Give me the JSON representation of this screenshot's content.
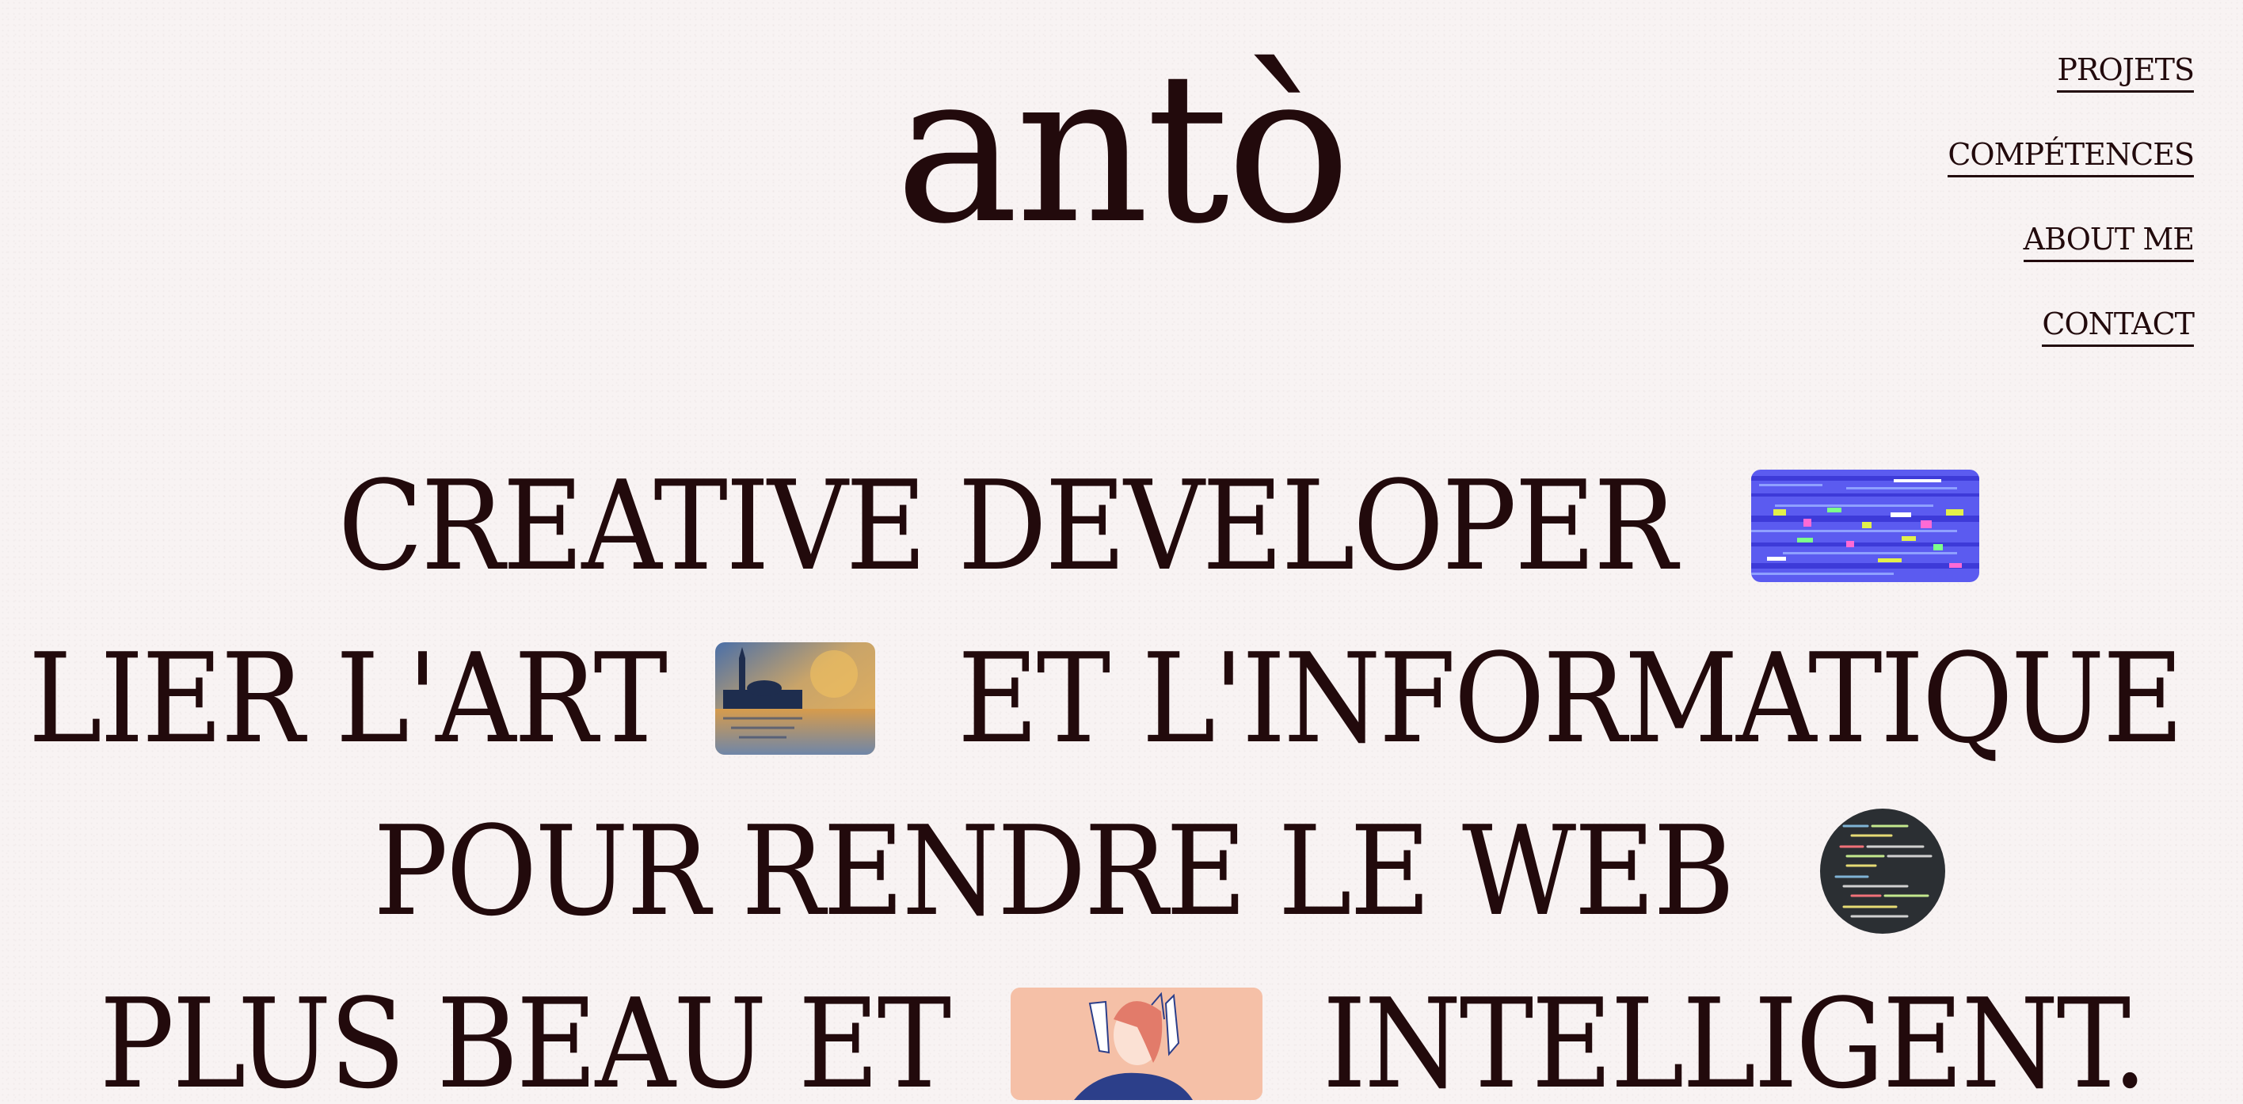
{
  "site": {
    "logo": "antò"
  },
  "nav": {
    "items": [
      {
        "label": "PROJETS"
      },
      {
        "label": "COMPÉTENCES"
      },
      {
        "label": "ABOUT ME"
      },
      {
        "label": "CONTACT"
      }
    ]
  },
  "hero": {
    "line1": {
      "text": "CREATIVE DEVELOPER"
    },
    "line2": {
      "text_a": "LIER L'ART",
      "text_b": "ET L'INFORMATIQUE"
    },
    "line3": {
      "text": "POUR RENDRE LE WEB"
    },
    "line4": {
      "text_a": "PLUS BEAU ET",
      "text_b": "INTELLIGENT."
    }
  },
  "colors": {
    "background": "#f8f3f3",
    "text": "#220a0c",
    "glitch_accent": "#5b5bf0",
    "monet_sky": "#e8b25a",
    "code_bg": "#2b2f33",
    "illustration_bg": "#f3b59a"
  },
  "images": {
    "glitch": "glitch-art-thumbnail",
    "monet": "painting-thumbnail",
    "code": "code-screen-thumbnail",
    "illustration": "illustration-thumbnail"
  }
}
